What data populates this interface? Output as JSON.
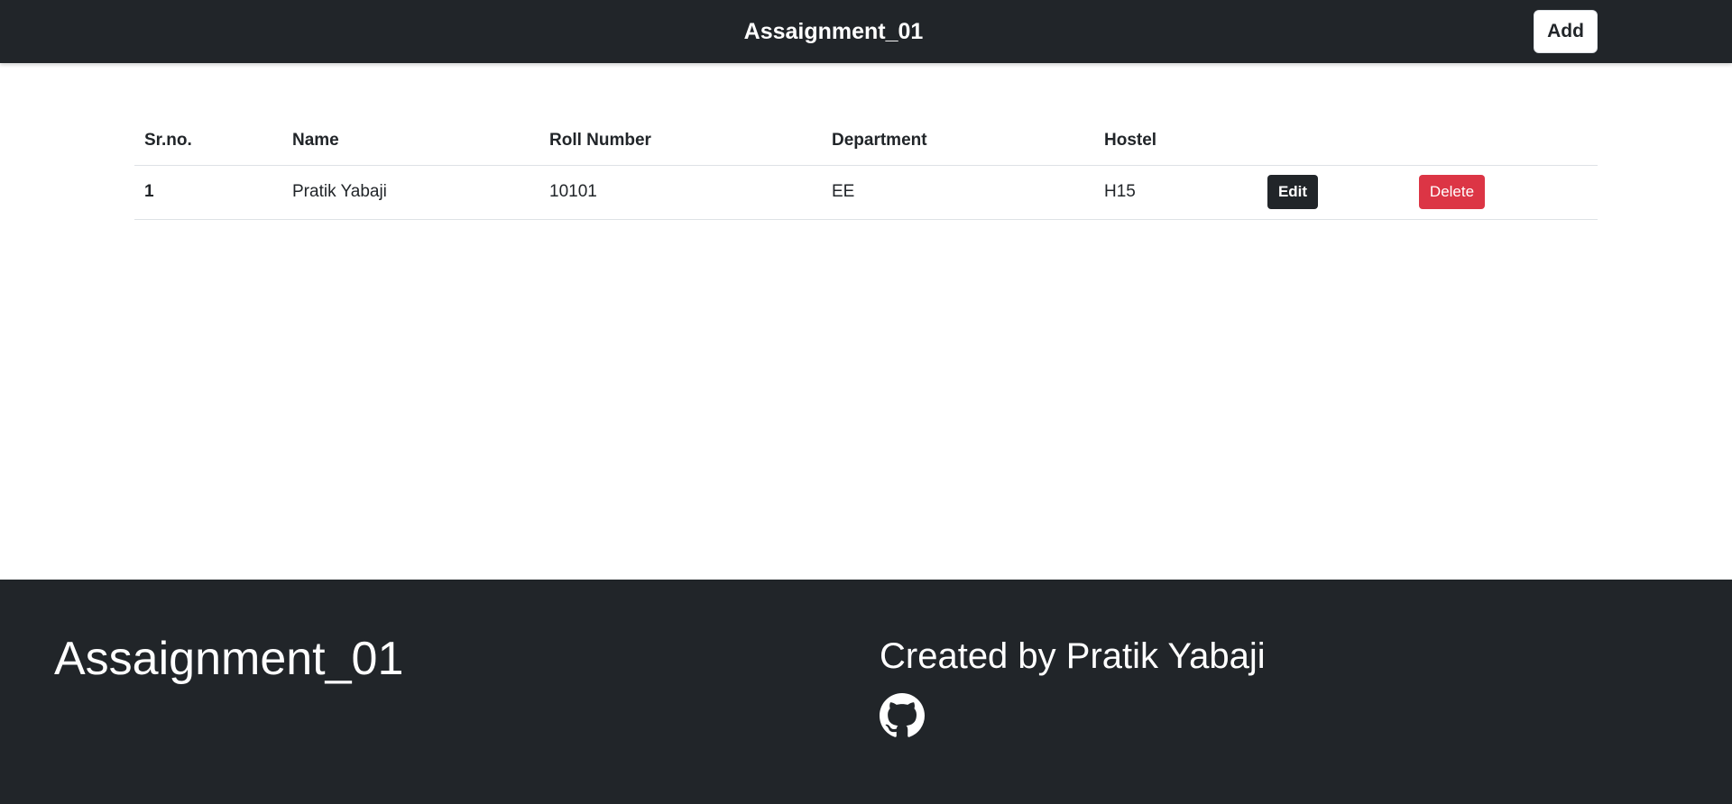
{
  "navbar": {
    "brand": "Assaignment_01",
    "add_label": "Add"
  },
  "table": {
    "headers": [
      "Sr.no.",
      "Name",
      "Roll Number",
      "Department",
      "Hostel"
    ],
    "rows": [
      {
        "sr_no": "1",
        "name": "Pratik Yabaji",
        "roll_number": "10101",
        "department": "EE",
        "hostel": "H15",
        "edit_label": "Edit",
        "delete_label": "Delete"
      }
    ]
  },
  "footer": {
    "title": "Assaignment_01",
    "credit": "Created by Pratik Yabaji",
    "icon": "github-icon"
  },
  "colors": {
    "dark": "#212529",
    "danger": "#dc3545",
    "light": "#ffffff"
  }
}
